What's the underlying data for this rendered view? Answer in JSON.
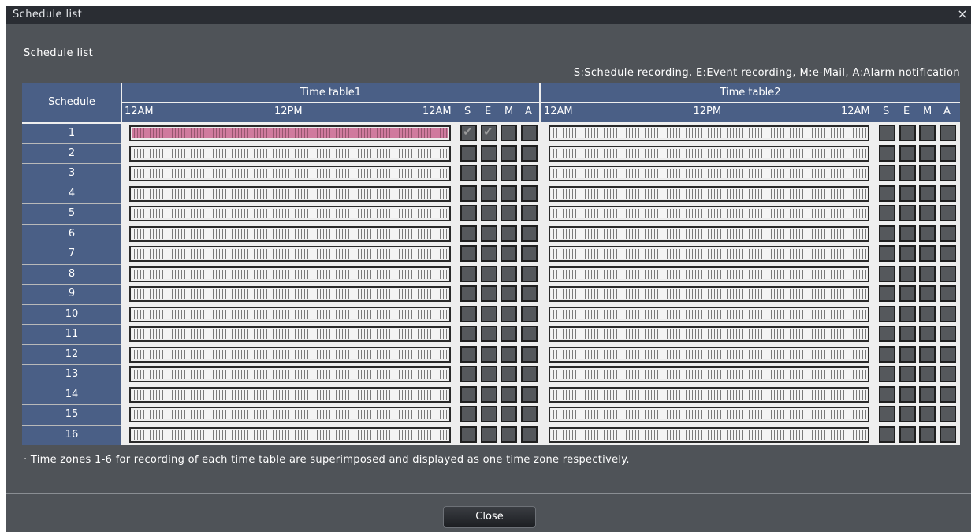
{
  "window": {
    "title": "Schedule list",
    "close_glyph": "×"
  },
  "panel_title": "Schedule list",
  "legend": "S:Schedule recording, E:Event recording, M:e-Mail, A:Alarm notification",
  "table": {
    "schedule_header": "Schedule",
    "time_tables": [
      {
        "name": "Time table1",
        "tick_start": "12AM",
        "tick_mid": "12PM",
        "tick_end": "12AM",
        "col_labels": [
          "S",
          "E",
          "M",
          "A"
        ]
      },
      {
        "name": "Time table2",
        "tick_start": "12AM",
        "tick_mid": "12PM",
        "tick_end": "12AM",
        "col_labels": [
          "S",
          "E",
          "M",
          "A"
        ]
      }
    ],
    "rows": [
      {
        "label": "1",
        "tt1_active": true,
        "tt1_checks": [
          true,
          true,
          false,
          false
        ],
        "tt2_active": false,
        "tt2_checks": [
          false,
          false,
          false,
          false
        ]
      },
      {
        "label": "2",
        "tt1_active": false,
        "tt1_checks": [
          false,
          false,
          false,
          false
        ],
        "tt2_active": false,
        "tt2_checks": [
          false,
          false,
          false,
          false
        ]
      },
      {
        "label": "3",
        "tt1_active": false,
        "tt1_checks": [
          false,
          false,
          false,
          false
        ],
        "tt2_active": false,
        "tt2_checks": [
          false,
          false,
          false,
          false
        ]
      },
      {
        "label": "4",
        "tt1_active": false,
        "tt1_checks": [
          false,
          false,
          false,
          false
        ],
        "tt2_active": false,
        "tt2_checks": [
          false,
          false,
          false,
          false
        ]
      },
      {
        "label": "5",
        "tt1_active": false,
        "tt1_checks": [
          false,
          false,
          false,
          false
        ],
        "tt2_active": false,
        "tt2_checks": [
          false,
          false,
          false,
          false
        ]
      },
      {
        "label": "6",
        "tt1_active": false,
        "tt1_checks": [
          false,
          false,
          false,
          false
        ],
        "tt2_active": false,
        "tt2_checks": [
          false,
          false,
          false,
          false
        ]
      },
      {
        "label": "7",
        "tt1_active": false,
        "tt1_checks": [
          false,
          false,
          false,
          false
        ],
        "tt2_active": false,
        "tt2_checks": [
          false,
          false,
          false,
          false
        ]
      },
      {
        "label": "8",
        "tt1_active": false,
        "tt1_checks": [
          false,
          false,
          false,
          false
        ],
        "tt2_active": false,
        "tt2_checks": [
          false,
          false,
          false,
          false
        ]
      },
      {
        "label": "9",
        "tt1_active": false,
        "tt1_checks": [
          false,
          false,
          false,
          false
        ],
        "tt2_active": false,
        "tt2_checks": [
          false,
          false,
          false,
          false
        ]
      },
      {
        "label": "10",
        "tt1_active": false,
        "tt1_checks": [
          false,
          false,
          false,
          false
        ],
        "tt2_active": false,
        "tt2_checks": [
          false,
          false,
          false,
          false
        ]
      },
      {
        "label": "11",
        "tt1_active": false,
        "tt1_checks": [
          false,
          false,
          false,
          false
        ],
        "tt2_active": false,
        "tt2_checks": [
          false,
          false,
          false,
          false
        ]
      },
      {
        "label": "12",
        "tt1_active": false,
        "tt1_checks": [
          false,
          false,
          false,
          false
        ],
        "tt2_active": false,
        "tt2_checks": [
          false,
          false,
          false,
          false
        ]
      },
      {
        "label": "13",
        "tt1_active": false,
        "tt1_checks": [
          false,
          false,
          false,
          false
        ],
        "tt2_active": false,
        "tt2_checks": [
          false,
          false,
          false,
          false
        ]
      },
      {
        "label": "14",
        "tt1_active": false,
        "tt1_checks": [
          false,
          false,
          false,
          false
        ],
        "tt2_active": false,
        "tt2_checks": [
          false,
          false,
          false,
          false
        ]
      },
      {
        "label": "15",
        "tt1_active": false,
        "tt1_checks": [
          false,
          false,
          false,
          false
        ],
        "tt2_active": false,
        "tt2_checks": [
          false,
          false,
          false,
          false
        ]
      },
      {
        "label": "16",
        "tt1_active": false,
        "tt1_checks": [
          false,
          false,
          false,
          false
        ],
        "tt2_active": false,
        "tt2_checks": [
          false,
          false,
          false,
          false
        ]
      }
    ]
  },
  "note": "· Time zones 1-6 for recording of each time table are superimposed and displayed as one time zone respectively.",
  "close_button": "Close",
  "colors": {
    "header": "#4a5f86",
    "active_timezone": "#d07a9e",
    "background": "#4f5358"
  }
}
